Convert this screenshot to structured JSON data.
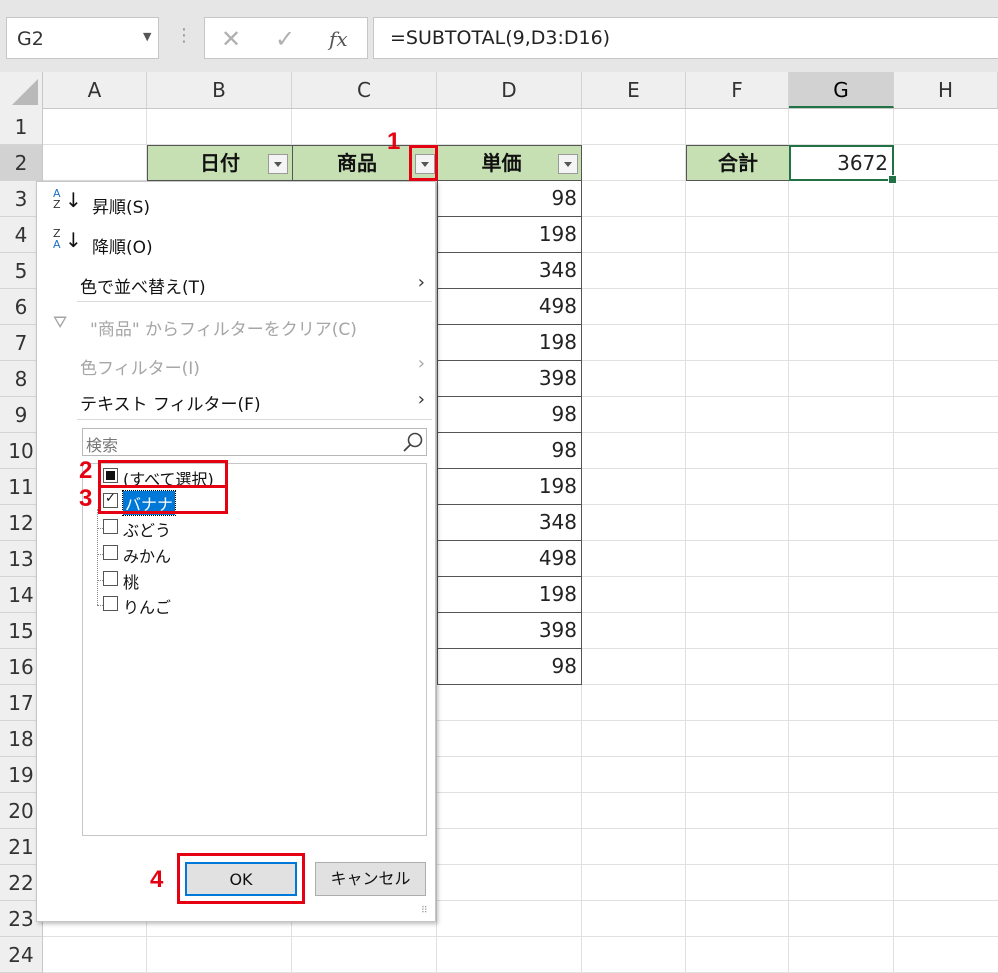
{
  "formula_bar": {
    "name_box": "G2",
    "cancel_icon": "✕",
    "enter_icon": "✓",
    "fx_label": "fx",
    "formula": "=SUBTOTAL(9,D3:D16)"
  },
  "columns": [
    "A",
    "B",
    "C",
    "D",
    "E",
    "F",
    "G",
    "H"
  ],
  "rows": [
    "1",
    "2",
    "3",
    "4",
    "5",
    "6",
    "7",
    "8",
    "9",
    "10",
    "11",
    "12",
    "13",
    "14",
    "15",
    "16",
    "17",
    "18",
    "19",
    "20",
    "21",
    "22",
    "23",
    "24"
  ],
  "table": {
    "headers": [
      "日付",
      "商品",
      "単価"
    ],
    "prices": [
      "98",
      "198",
      "348",
      "498",
      "198",
      "398",
      "98",
      "98",
      "198",
      "348",
      "498",
      "198",
      "398",
      "98"
    ]
  },
  "total": {
    "label": "合計",
    "value": "3672"
  },
  "filter_menu": {
    "sort_asc": "昇順(S)",
    "sort_desc": "降順(O)",
    "sort_by_color": "色で並べ替え(T)",
    "clear_filter": "\"商品\" からフィルターをクリア(C)",
    "color_filter": "色フィルター(I)",
    "text_filter": "テキスト フィルター(F)",
    "search_placeholder": "検索",
    "items": [
      "(すべて選択)",
      "バナナ",
      "ぶどう",
      "みかん",
      "桃",
      "りんご"
    ],
    "ok": "OK",
    "cancel": "キャンセル"
  },
  "annotations": [
    "1",
    "2",
    "3",
    "4"
  ],
  "colors": {
    "header_fill": "#c6e0b4",
    "selection": "#217346",
    "highlight": "#0078d7",
    "annotation": "#e50012"
  }
}
